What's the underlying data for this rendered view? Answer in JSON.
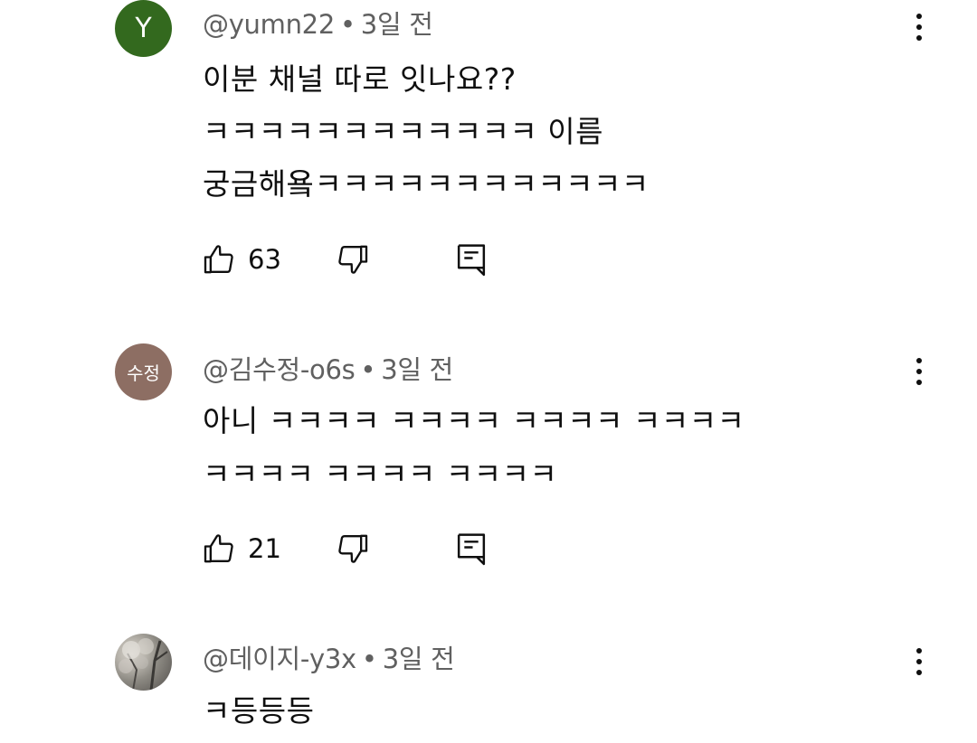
{
  "comments": [
    {
      "avatar_text": "Y",
      "author": "@yumn22",
      "separator": "•",
      "time": "3일 전",
      "lines": [
        "이분 채널 따로 잇나요??",
        "ㅋㅋㅋㅋㅋㅋㅋㅋㅋㅋㅋㅋ 이름",
        "궁금해욬ㅋㅋㅋㅋㅋㅋㅋㅋㅋㅋㅋㅋ"
      ],
      "likes": "63"
    },
    {
      "avatar_text": "수정",
      "author": "@김수정-o6s",
      "separator": "•",
      "time": "3일 전",
      "lines": [
        "아니 ㅋㅋㅋㅋ ㅋㅋㅋㅋ ㅋㅋㅋㅋ ㅋㅋㅋㅋ",
        "ㅋㅋㅋㅋ ㅋㅋㅋㅋ ㅋㅋㅋㅋ"
      ],
      "likes": "21"
    },
    {
      "avatar_text": "",
      "author": "@데이지-y3x",
      "separator": "•",
      "time": "3일 전",
      "lines": [
        "ㅋ등등등"
      ]
    }
  ],
  "colors": {
    "avatar_green": "#33691e",
    "avatar_brown": "#8d6e63",
    "text_primary": "#0f0f0f",
    "text_secondary": "#606060"
  },
  "icons": {
    "like": "thumbs-up-icon",
    "dislike": "thumbs-down-icon",
    "reply": "reply-comment-icon",
    "more": "more-vert-icon"
  }
}
